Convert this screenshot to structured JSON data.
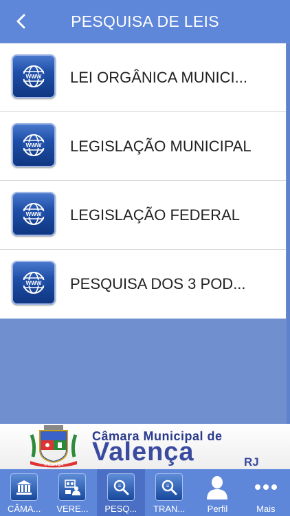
{
  "header": {
    "title": "PESQUISA DE LEIS"
  },
  "list": {
    "items": [
      {
        "label": "LEI ORGÂNICA MUNICI...",
        "icon": "www-globe-icon"
      },
      {
        "label": "LEGISLAÇÃO MUNICIPAL",
        "icon": "www-globe-icon"
      },
      {
        "label": "LEGISLAÇÃO FEDERAL",
        "icon": "www-globe-icon"
      },
      {
        "label": "PESQUISA DOS 3 POD...",
        "icon": "www-globe-icon"
      }
    ]
  },
  "banner": {
    "line1": "Câmara Municipal de",
    "line2": "Valença",
    "suffix": "RJ",
    "crest_text": "VALENÇA"
  },
  "tabbar": {
    "tabs": [
      {
        "label": "CÂMA...",
        "icon": "building-icon",
        "active": false
      },
      {
        "label": "VERE...",
        "icon": "people-board-icon",
        "active": false
      },
      {
        "label": "PESQ...",
        "icon": "search-icon",
        "active": true
      },
      {
        "label": "TRAN...",
        "icon": "search-icon",
        "active": false
      },
      {
        "label": "Perfil",
        "icon": "person-icon",
        "active": false
      },
      {
        "label": "Mais",
        "icon": "more-dots-icon",
        "active": false
      }
    ]
  },
  "colors": {
    "header": "#5e86d9",
    "background": "#6f8fcf",
    "active_tab": "#4a6fc4",
    "text": "#222222"
  }
}
